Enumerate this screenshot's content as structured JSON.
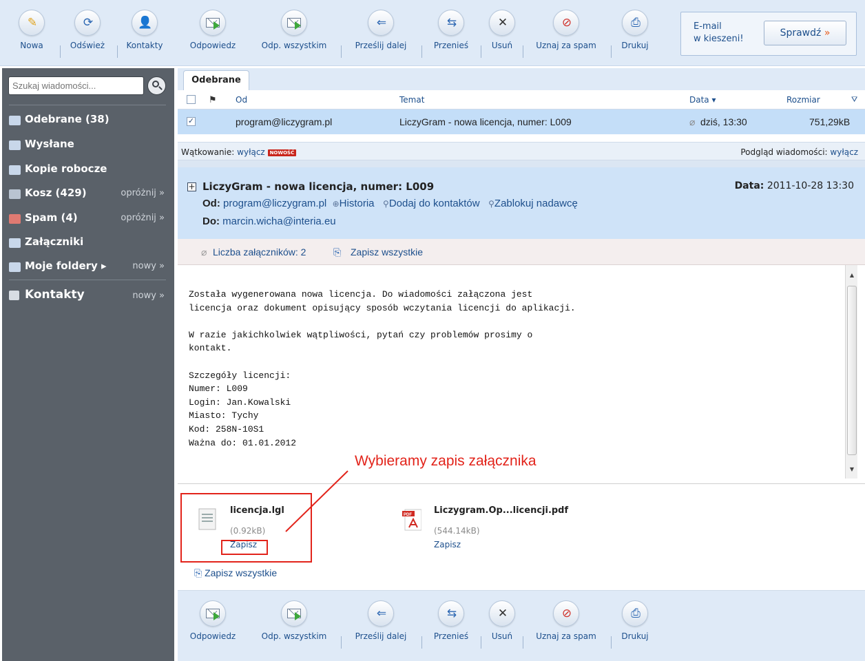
{
  "toolbar_left": {
    "new": "Nowa",
    "refresh": "Odśwież",
    "contacts": "Kontakty"
  },
  "toolbar_actions": {
    "reply": "Odpowiedz",
    "reply_all": "Odp. wszystkim",
    "forward": "Prześlij dalej",
    "move": "Przenieś",
    "delete": "Usuń",
    "spam": "Uznaj za spam",
    "print": "Drukuj"
  },
  "promo": {
    "line1": "E-mail",
    "line2": "w kieszeni!",
    "button": "Sprawdź",
    "chevron": "»"
  },
  "sidebar": {
    "search_placeholder": "Szukaj wiadomości...",
    "items": [
      {
        "label": "Odebrane  (38)",
        "action": ""
      },
      {
        "label": "Wysłane",
        "action": ""
      },
      {
        "label": "Kopie robocze",
        "action": ""
      },
      {
        "label": "Kosz  (429)",
        "action": "opróżnij »"
      },
      {
        "label": "Spam  (4)",
        "action": "opróżnij »"
      },
      {
        "label": "Załączniki",
        "action": ""
      },
      {
        "label": "Moje foldery ▸",
        "action": "nowy »"
      },
      {
        "label": "Kontakty",
        "action": "nowy »"
      }
    ]
  },
  "mail_list": {
    "tab": "Odebrane",
    "columns": {
      "from": "Od",
      "subject": "Temat",
      "date": "Data ▾",
      "size": "Rozmiar"
    },
    "rows": [
      {
        "from": "program@liczygram.pl",
        "subject": "LiczyGram - nowa licencja, numer: L009",
        "date": "dziś, 13:30",
        "size": "751,29kB"
      }
    ]
  },
  "thread_bar": {
    "label": "Wątkowanie:",
    "toggle": "wyłącz",
    "badge": "NOWOŚĆ",
    "preview_label": "Podgląd wiadomości:",
    "preview_toggle": "wyłącz"
  },
  "message": {
    "subject": "LiczyGram - nowa licencja, numer: L009",
    "date_label": "Data:",
    "date": "2011-10-28 13:30",
    "from_label": "Od:",
    "from": "program@liczygram.pl",
    "history": "Historia",
    "add_contact": "Dodaj do kontaktów",
    "block": "Zablokuj nadawcę",
    "to_label": "Do:",
    "to": "marcin.wicha@interia.eu",
    "attachment_count": "Liczba załączników: 2",
    "save_all": "Zapisz wszystkie",
    "body": "Została wygenerowana nowa licencja. Do wiadomości załączona jest\nlicencja oraz dokument opisujący sposób wczytania licencji do aplikacji.\n\nW razie jakichkolwiek wątpliwości, pytań czy problemów prosimy o\nkontakt.\n\nSzczegóły licencji:\nNumer: L009\nLogin: Jan.Kowalski\nMiasto: Tychy\nKod: 258N-10S1\nWażna do: 01.01.2012"
  },
  "annotation": "Wybieramy zapis załącznika",
  "attachments": [
    {
      "name": "licencja.lgl",
      "size": "(0.92kB)",
      "save": "Zapisz"
    },
    {
      "name": "Liczygram.Op...licencji.pdf",
      "size": "(544.14kB)",
      "save": "Zapisz"
    }
  ],
  "colors": {
    "accent": "#1d4f8c",
    "sidebar": "#5a6169",
    "toolbar": "#dfeaf7",
    "annotation": "#e2231a"
  },
  "icons": [
    "compose-icon",
    "refresh-icon",
    "contacts-icon",
    "reply-icon",
    "reply-all-icon",
    "forward-icon",
    "move-icon",
    "delete-icon",
    "spam-icon",
    "print-icon",
    "search-icon",
    "inbox-icon",
    "sent-icon",
    "drafts-icon",
    "trash-icon",
    "spam-folder-icon",
    "attachments-folder-icon",
    "folders-icon",
    "contacts-folder-icon",
    "paperclip-icon",
    "save-all-icon",
    "file-icon",
    "pdf-icon"
  ]
}
